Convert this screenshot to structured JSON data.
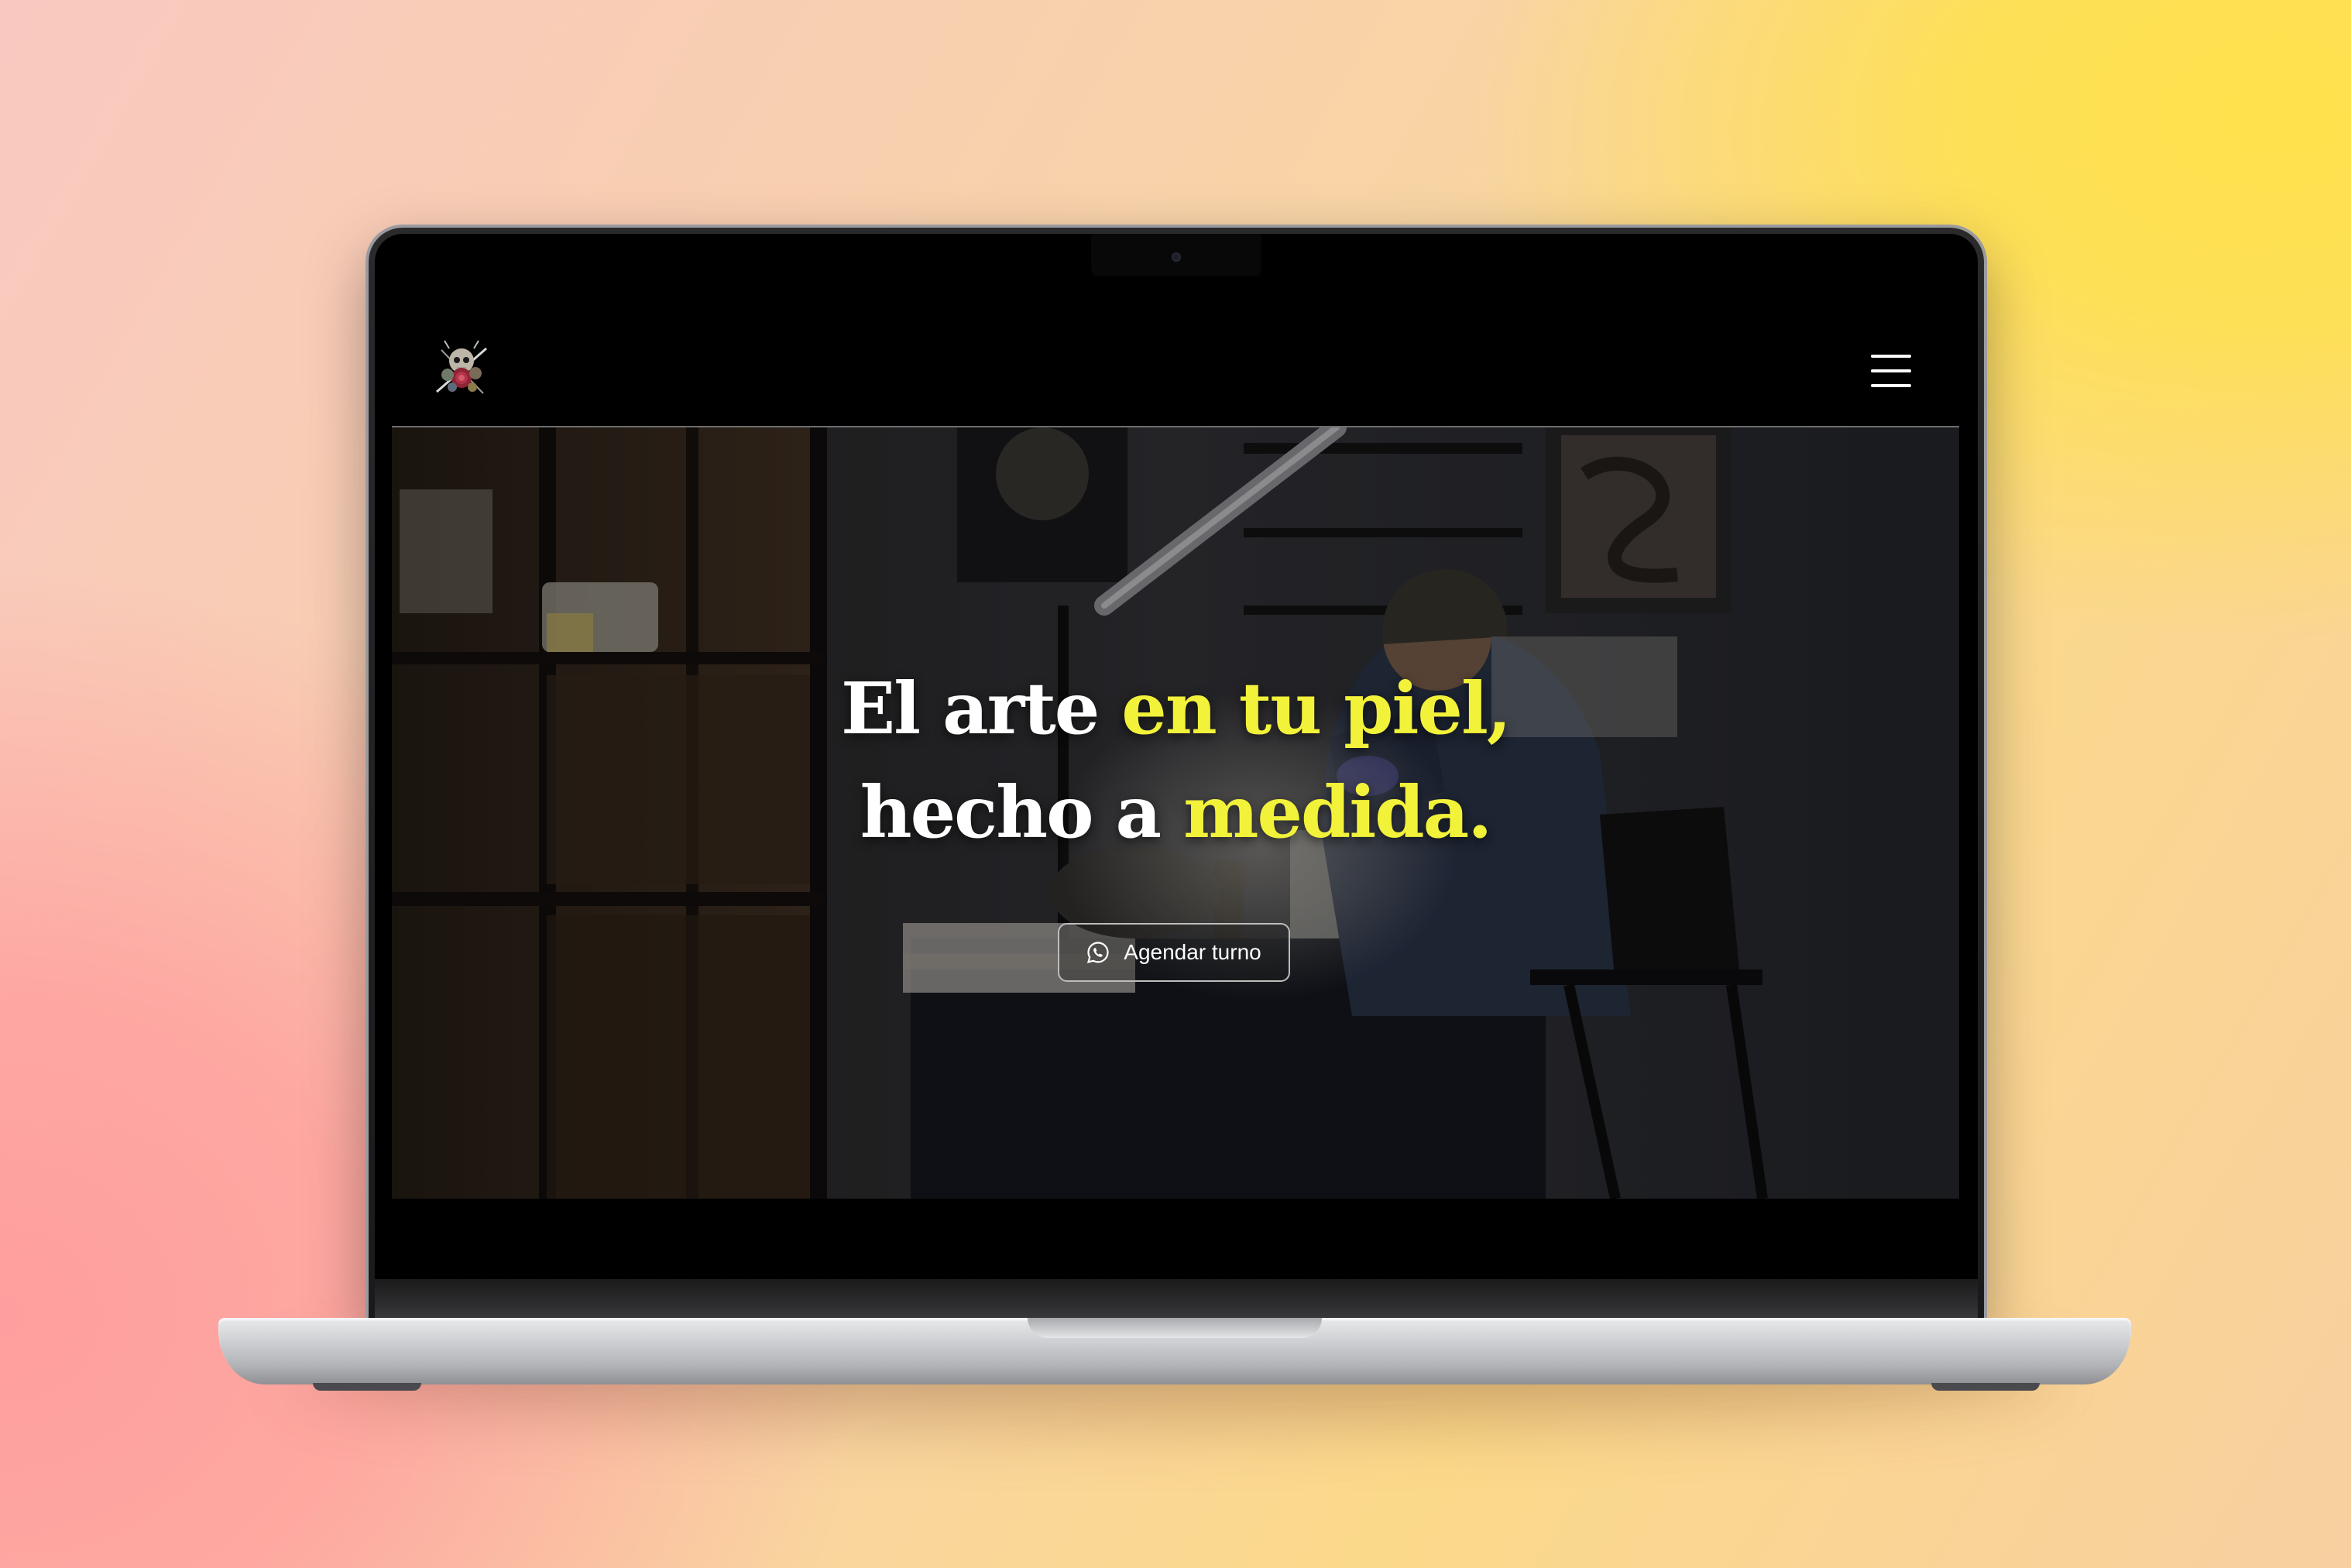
{
  "hero": {
    "title_line1": [
      {
        "text": "El arte ",
        "highlight": false
      },
      {
        "text": "en tu ",
        "highlight": true
      },
      {
        "text": "piel,",
        "highlight": true
      }
    ],
    "title_line2": [
      {
        "text": "hecho a ",
        "highlight": false
      },
      {
        "text": "medida.",
        "highlight": true
      }
    ],
    "cta_label": "Agendar turno",
    "cta_icon": "whatsapp-icon"
  },
  "header": {
    "logo_icon": "skull-flower-logo",
    "menu_icon": "hamburger-menu-icon"
  },
  "colors": {
    "highlight": "#f2f23a",
    "header_bg": "#000000",
    "text": "#ffffff"
  }
}
